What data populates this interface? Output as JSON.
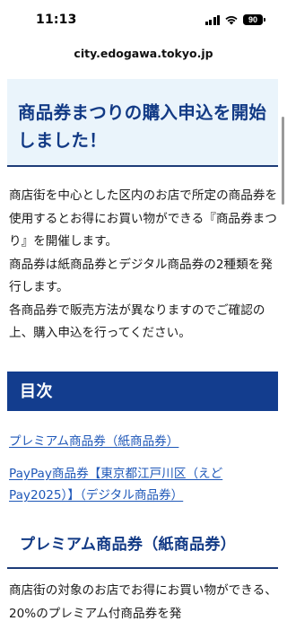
{
  "status_bar": {
    "time": "11:13",
    "battery": "90"
  },
  "browser": {
    "url": "city.edogawa.tokyo.jp"
  },
  "article": {
    "headline": "商品券まつりの購入申込を開始しました！",
    "intro": [
      "商店街を中心とした区内のお店で所定の商品券を使用するとお得にお買い物ができる『商品券まつり』を開催します。",
      "商品券は紙商品券とデジタル商品券の2種類を発行します。",
      "各商品券で販売方法が異なりますのでご確認の上、購入申込を行ってください。"
    ],
    "toc": {
      "heading": "目次",
      "links": [
        "プレミアム商品券（紙商品券）",
        "PayPay商品券【東京都江戸川区（えどPay2025）】（デジタル商品券）"
      ]
    },
    "section": {
      "heading": "プレミアム商品券（紙商品券）",
      "body": "商店街の対象のお店でお得にお買い物ができる、20%のプレミアム付商品券を発"
    }
  },
  "colors": {
    "primary_navy": "#133d8e",
    "headline_bg": "#eaf4fb",
    "link_blue": "#1e57b8"
  }
}
